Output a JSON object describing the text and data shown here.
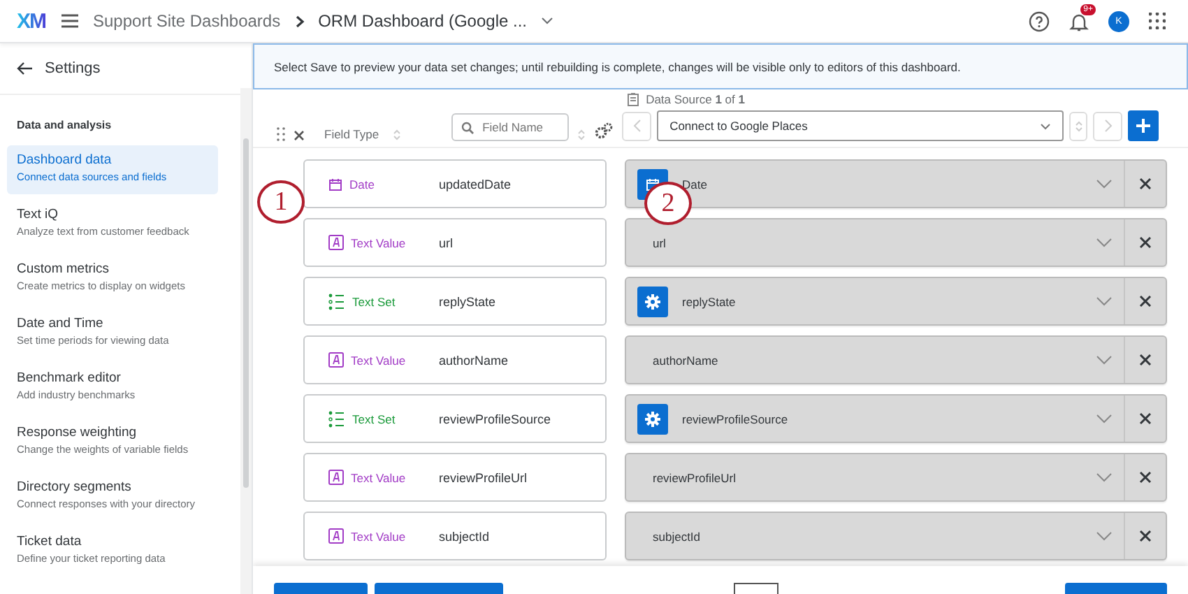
{
  "header": {
    "logo": "XM",
    "breadcrumb": [
      "Support Site Dashboards",
      "ORM Dashboard (Google ..."
    ],
    "notification_badge": "9+",
    "avatar": "K"
  },
  "sidebar": {
    "back_label": "Settings",
    "section": "Data and analysis",
    "items": [
      {
        "title": "Dashboard data",
        "subtitle": "Connect data sources and fields",
        "selected": true
      },
      {
        "title": "Text iQ",
        "subtitle": "Analyze text from customer feedback",
        "selected": false
      },
      {
        "title": "Custom metrics",
        "subtitle": "Create metrics to display on widgets",
        "selected": false
      },
      {
        "title": "Date and Time",
        "subtitle": "Set time periods for viewing data",
        "selected": false
      },
      {
        "title": "Benchmark editor",
        "subtitle": "Add industry benchmarks",
        "selected": false
      },
      {
        "title": "Response weighting",
        "subtitle": "Change the weights of variable fields",
        "selected": false
      },
      {
        "title": "Directory segments",
        "subtitle": "Connect responses with your directory",
        "selected": false
      },
      {
        "title": "Ticket data",
        "subtitle": "Define your ticket reporting data",
        "selected": false
      }
    ]
  },
  "banner": "Select Save to preview your data set changes; until rebuilding is complete, changes will be visible only to editors of this dashboard.",
  "toolbar": {
    "field_type_label": "Field Type",
    "search_placeholder": "Field Name",
    "data_source": "Data Source **1** of **1**",
    "source_value": "Connect to Google Places"
  },
  "fields": [
    {
      "kind": "date",
      "type_label": "Date",
      "name": "updatedDate",
      "mapping": {
        "kind": "date",
        "label": "Date"
      }
    },
    {
      "kind": "text_value",
      "type_label": "Text Value",
      "name": "url",
      "mapping": {
        "kind": "plain",
        "label": "url"
      }
    },
    {
      "kind": "text_set",
      "type_label": "Text Set",
      "name": "replyState",
      "mapping": {
        "kind": "text_set",
        "label": "replyState"
      }
    },
    {
      "kind": "text_value",
      "type_label": "Text Value",
      "name": "authorName",
      "mapping": {
        "kind": "plain",
        "label": "authorName"
      }
    },
    {
      "kind": "text_set",
      "type_label": "Text Set",
      "name": "reviewProfileSource",
      "mapping": {
        "kind": "text_set",
        "label": "reviewProfileSource"
      }
    },
    {
      "kind": "text_value",
      "type_label": "Text Value",
      "name": "reviewProfileUrl",
      "mapping": {
        "kind": "plain",
        "label": "reviewProfileUrl"
      }
    },
    {
      "kind": "text_value",
      "type_label": "Text Value",
      "name": "subjectId",
      "mapping": {
        "kind": "plain",
        "label": "subjectId"
      }
    }
  ],
  "callouts": [
    "1",
    "2"
  ]
}
